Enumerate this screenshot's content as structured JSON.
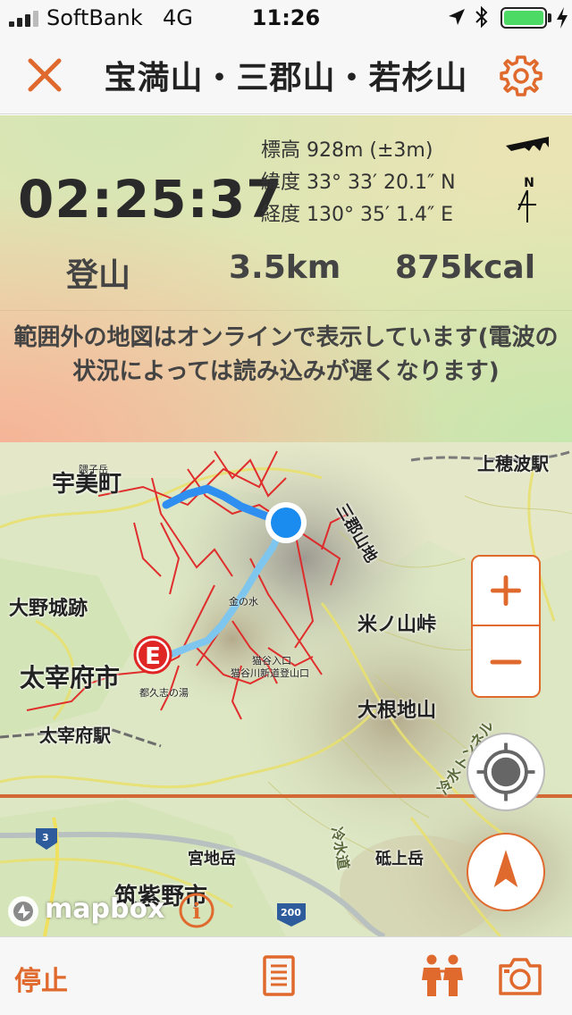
{
  "status_bar": {
    "carrier": "SoftBank",
    "network": "4G",
    "time": "11:26",
    "battery_color": "#4cd964",
    "icons": [
      "signal-icon",
      "location-arrow-icon",
      "bluetooth-icon",
      "battery-icon",
      "charging-icon"
    ]
  },
  "nav": {
    "title": "宝満山・三郡山・若杉山",
    "accent": "#e06a2d",
    "icons": [
      "close-icon",
      "gear-icon"
    ]
  },
  "info": {
    "elapsed_time": "02:25:37",
    "altitude": "標高 928m (±3m)",
    "latitude": "緯度 33° 33′ 20.1″ N",
    "longitude": "経度 130° 35′ 1.4″ E",
    "compass_label": "N",
    "mode": "登山",
    "distance": "3.5km",
    "calories": "875kcal",
    "notice": "範囲外の地図はオンラインで表示しています(電波の状況によっては読み込みが遅くなります)"
  },
  "map": {
    "labels": {
      "ujimachi": "宇美町",
      "kamihonami": "上穂波駅",
      "onojo_ruins": "大野城跡",
      "dazaifu_city": "太宰府市",
      "dazaifu_station": "太宰府駅",
      "komenoyama": "米ノ山峠",
      "onebuyama": "大根地山",
      "tsukushino": "筑紫野市",
      "sankoyama": "三郡山地",
      "miyajidake": "宮地岳",
      "kubote": "隈子岳",
      "kuwashi_no_yu": "都久志の湯",
      "hoshidani": "猫谷入口",
      "nekoya": "猫谷川新道登山口",
      "kin_no_mizu": "金の水",
      "route_3": "3",
      "route_200": "200",
      "hiyamizu_tunnel": "冷水トンネル",
      "hiyamizu": "冷水道",
      "sode": "砥上岳"
    },
    "start_marker": "E",
    "zoom_in": "+",
    "zoom_out": "−",
    "attribution": "mapbox",
    "info_symbol": "i",
    "icons": [
      "zoom-in-icon",
      "zoom-out-icon",
      "locate-icon",
      "north-arrow-icon",
      "mapbox-logo-icon",
      "info-icon"
    ]
  },
  "toolbar": {
    "stop_label": "停止",
    "icons": [
      "log-icon",
      "people-icon",
      "camera-icon"
    ]
  }
}
